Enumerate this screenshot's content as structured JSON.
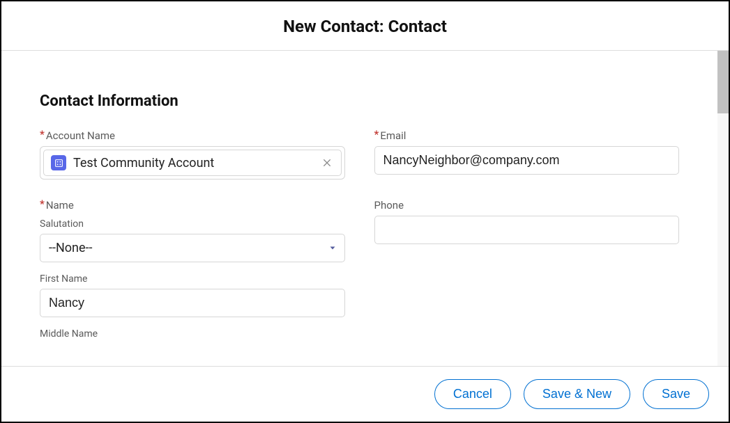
{
  "modal": {
    "title": "New Contact: Contact"
  },
  "section": {
    "title": "Contact Information"
  },
  "fields": {
    "accountName": {
      "label": "Account Name",
      "value": "Test Community Account"
    },
    "email": {
      "label": "Email",
      "value": "NancyNeighbor@company.com"
    },
    "name": {
      "label": "Name"
    },
    "salutation": {
      "label": "Salutation",
      "value": "--None--"
    },
    "firstName": {
      "label": "First Name",
      "value": "Nancy"
    },
    "middleName": {
      "label": "Middle Name",
      "value": ""
    },
    "phone": {
      "label": "Phone",
      "value": ""
    }
  },
  "footer": {
    "cancel": "Cancel",
    "saveNew": "Save & New",
    "save": "Save"
  }
}
